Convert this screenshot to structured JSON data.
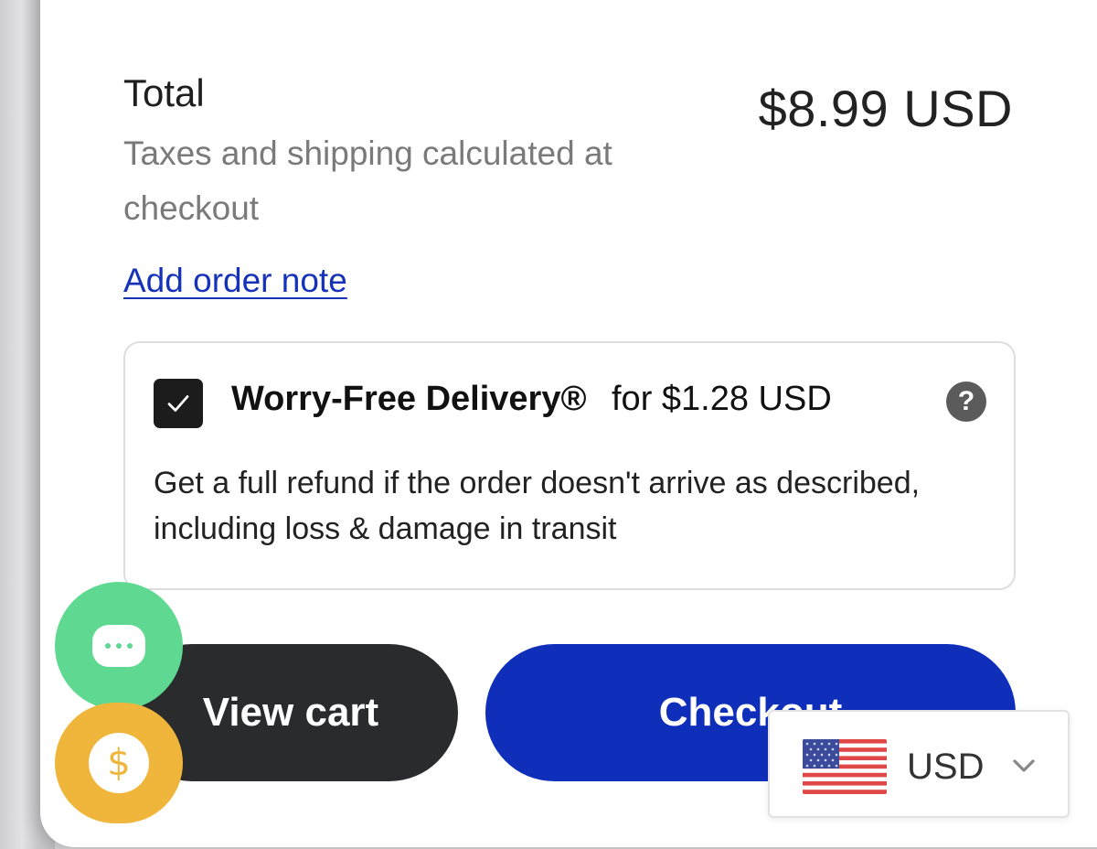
{
  "cart_summary": {
    "total_label": "Total",
    "total_amount": "$8.99 USD",
    "taxes_note": "Taxes and shipping calculated at checkout",
    "order_note_link": "Add order note"
  },
  "worry_free": {
    "checked": true,
    "title": "Worry-Free Delivery®",
    "price_text": "for $1.28 USD",
    "help_icon": "question-circle-icon",
    "description": "Get a full refund if the order doesn't arrive as described, including loss & damage in transit"
  },
  "actions": {
    "view_cart_label": "View cart",
    "checkout_label": "Checkout"
  },
  "floating": {
    "chat_icon": "chat-bubble-icon",
    "currency_icon": "dollar-icon",
    "currency_symbol": "$"
  },
  "currency_selector": {
    "flag": "us-flag-icon",
    "code": "USD",
    "dropdown_icon": "chevron-down-icon"
  },
  "colors": {
    "checkout_blue": "#0f2fbb",
    "view_cart_dark": "#2a2b2d",
    "chat_green": "#5fd991",
    "currency_yellow": "#f0b63c",
    "link_blue": "#1532b8"
  }
}
